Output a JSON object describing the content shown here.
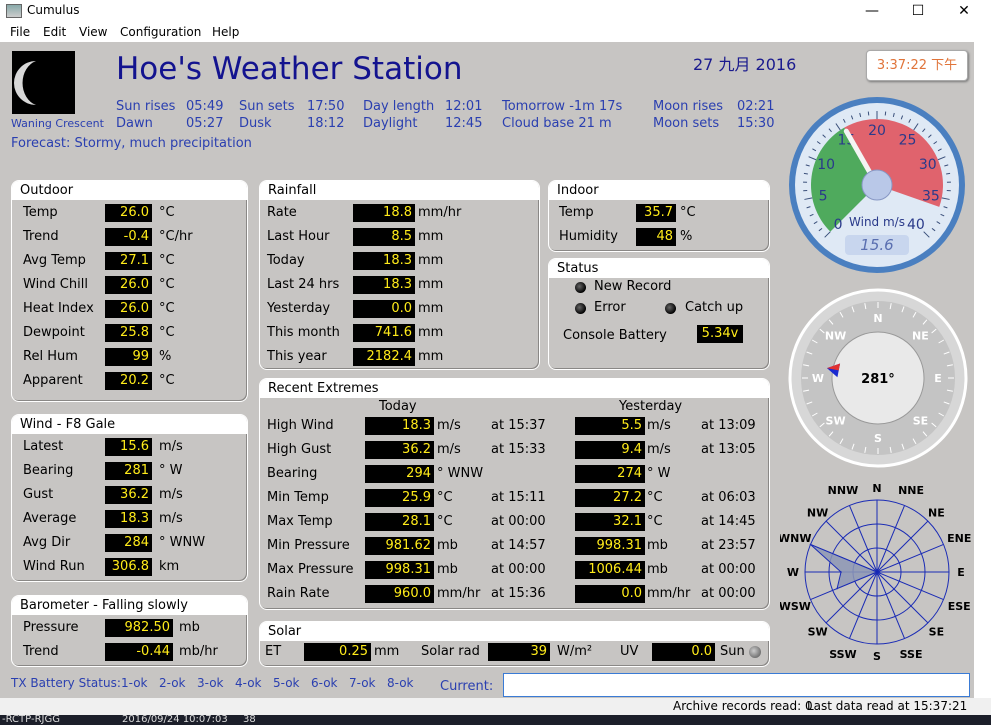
{
  "window": {
    "title": "Cumulus",
    "minimize": "—",
    "maximize": "☐",
    "close": "✕"
  },
  "menu": [
    "File",
    "Edit",
    "View",
    "Configuration",
    "Help"
  ],
  "header": {
    "station_name": "Hoe's Weather Station",
    "date": "27 九月 2016",
    "time": "3:37:22 下午",
    "moon_phase": "Waning Crescent",
    "forecast": "Forecast: Stormy, much precipitation"
  },
  "astro": {
    "sun_rises_label": "Sun rises",
    "sun_rises": "05:49",
    "sun_sets_label": "Sun sets",
    "sun_sets": "17:50",
    "day_length_label": "Day length",
    "day_length": "12:01",
    "tomorrow": "Tomorrow -1m 17s",
    "moon_rises_label": "Moon rises",
    "moon_rises": "02:21",
    "dawn_label": "Dawn",
    "dawn": "05:27",
    "dusk_label": "Dusk",
    "dusk": "18:12",
    "daylight_label": "Daylight",
    "daylight": "12:45",
    "cloud_base": "Cloud base 21 m",
    "moon_sets_label": "Moon sets",
    "moon_sets": "15:30"
  },
  "outdoor": {
    "title": "Outdoor",
    "rows": [
      {
        "label": "Temp",
        "value": "26.0",
        "unit": "°C"
      },
      {
        "label": "Trend",
        "value": "-0.4",
        "unit": "°C/hr"
      },
      {
        "label": "Avg Temp",
        "value": "27.1",
        "unit": "°C"
      },
      {
        "label": "Wind Chill",
        "value": "26.0",
        "unit": "°C"
      },
      {
        "label": "Heat Index",
        "value": "26.0",
        "unit": "°C"
      },
      {
        "label": "Dewpoint",
        "value": "25.8",
        "unit": "°C"
      },
      {
        "label": "Rel Hum",
        "value": "99",
        "unit": "%"
      },
      {
        "label": "Apparent",
        "value": "20.2",
        "unit": "°C"
      }
    ]
  },
  "wind": {
    "title": "Wind - F8 Gale",
    "rows": [
      {
        "label": "Latest",
        "value": "15.6",
        "unit": "m/s"
      },
      {
        "label": "Bearing",
        "value": "281",
        "unit": "°  W"
      },
      {
        "label": "Gust",
        "value": "36.2",
        "unit": "m/s"
      },
      {
        "label": "Average",
        "value": "18.3",
        "unit": "m/s"
      },
      {
        "label": "Avg Dir",
        "value": "284",
        "unit": "°  WNW"
      },
      {
        "label": "Wind Run",
        "value": "306.8",
        "unit": "km"
      }
    ]
  },
  "barometer": {
    "title": "Barometer - Falling slowly",
    "rows": [
      {
        "label": "Pressure",
        "value": "982.50",
        "unit": "mb"
      },
      {
        "label": "Trend",
        "value": "-0.44",
        "unit": "mb/hr"
      }
    ]
  },
  "rainfall": {
    "title": "Rainfall",
    "rows": [
      {
        "label": "Rate",
        "value": "18.8",
        "unit": "mm/hr"
      },
      {
        "label": "Last Hour",
        "value": "8.5",
        "unit": "mm"
      },
      {
        "label": "Today",
        "value": "18.3",
        "unit": "mm"
      },
      {
        "label": "Last 24 hrs",
        "value": "18.3",
        "unit": "mm"
      },
      {
        "label": "Yesterday",
        "value": "0.0",
        "unit": "mm"
      },
      {
        "label": "This month",
        "value": "741.6",
        "unit": "mm"
      },
      {
        "label": "This year",
        "value": "2182.4",
        "unit": "mm"
      }
    ]
  },
  "indoor": {
    "title": "Indoor",
    "rows": [
      {
        "label": "Temp",
        "value": "35.7",
        "unit": "°C"
      },
      {
        "label": "Humidity",
        "value": "48",
        "unit": "%"
      }
    ]
  },
  "status": {
    "title": "Status",
    "new_record": "New Record",
    "error": "Error",
    "catch_up": "Catch up",
    "console_battery_label": "Console Battery",
    "console_battery": "5.34v"
  },
  "extremes": {
    "title": "Recent Extremes",
    "today_header": "Today",
    "yesterday_header": "Yesterday",
    "rows": [
      {
        "label": "High Wind",
        "today": "18.3",
        "tunit": "m/s",
        "tat": "at 15:37",
        "yday": "5.5",
        "yunit": "m/s",
        "yat": "at 13:09"
      },
      {
        "label": "High Gust",
        "today": "36.2",
        "tunit": "m/s",
        "tat": "at 15:33",
        "yday": "9.4",
        "yunit": "m/s",
        "yat": "at 13:05"
      },
      {
        "label": "Bearing",
        "today": "294",
        "tunit": "°  WNW",
        "tat": "",
        "yday": "274",
        "yunit": "°   W",
        "yat": ""
      },
      {
        "label": "Min Temp",
        "today": "25.9",
        "tunit": "°C",
        "tat": "at 15:11",
        "yday": "27.2",
        "yunit": "°C",
        "yat": "at 06:03"
      },
      {
        "label": "Max Temp",
        "today": "28.1",
        "tunit": "°C",
        "tat": "at 00:00",
        "yday": "32.1",
        "yunit": "°C",
        "yat": "at 14:45"
      },
      {
        "label": "Min Pressure",
        "today": "981.62",
        "tunit": "mb",
        "tat": "at 14:57",
        "yday": "998.31",
        "yunit": "mb",
        "yat": "at 23:57"
      },
      {
        "label": "Max Pressure",
        "today": "998.31",
        "tunit": "mb",
        "tat": "at 00:00",
        "yday": "1006.44",
        "yunit": "mb",
        "yat": "at 00:00"
      },
      {
        "label": "Rain Rate",
        "today": "960.0",
        "tunit": "mm/hr",
        "tat": "at 15:36",
        "yday": "0.0",
        "yunit": "mm/hr",
        "yat": "at 00:00"
      }
    ]
  },
  "solar": {
    "title": "Solar",
    "et_label": "ET",
    "et": "0.25",
    "et_unit": "mm",
    "rad_label": "Solar rad",
    "rad": "39",
    "rad_unit": "W/m²",
    "uv_label": "UV",
    "uv": "0.0",
    "sun_label": "Sun"
  },
  "tx_battery": {
    "label": "TX Battery Status:",
    "items": [
      "1-ok",
      "2-ok",
      "3-ok",
      "4-ok",
      "5-ok",
      "6-ok",
      "7-ok",
      "8-ok"
    ]
  },
  "current_label": "Current:",
  "statusbar": {
    "archive": "Archive records read: 0",
    "last_data": "Last data read at 15:37:21"
  },
  "taskbar": {
    "left": "-RCTP-RJGG",
    "date": "2016/09/24 10:07:03",
    "extra": "38"
  },
  "gauge": {
    "ticks": [
      "0",
      "5",
      "10",
      "15",
      "20",
      "25",
      "30",
      "35",
      "40"
    ],
    "label": "Wind m/s",
    "value": 15.6,
    "gust": 36.2,
    "colors": {
      "low": "#3fa34d",
      "high": "#e0545e",
      "dial": "#dfe9f5",
      "rim": "#4a7fc0"
    }
  },
  "compass": {
    "directions": [
      "N",
      "NE",
      "E",
      "SE",
      "S",
      "SW",
      "W",
      "NW"
    ],
    "bearing_text": "281°",
    "bearing": 281
  },
  "chart_data": {
    "type": "radar",
    "categories": [
      "N",
      "NNE",
      "NE",
      "ENE",
      "E",
      "ESE",
      "SE",
      "SSE",
      "S",
      "SSW",
      "SW",
      "WSW",
      "W",
      "WNW",
      "NW",
      "NNW"
    ],
    "values": [
      0,
      0,
      0,
      0,
      0,
      0,
      0,
      0,
      0,
      0,
      0,
      0.6,
      0.5,
      1.0,
      0,
      0
    ],
    "color": "#8d96b5"
  }
}
